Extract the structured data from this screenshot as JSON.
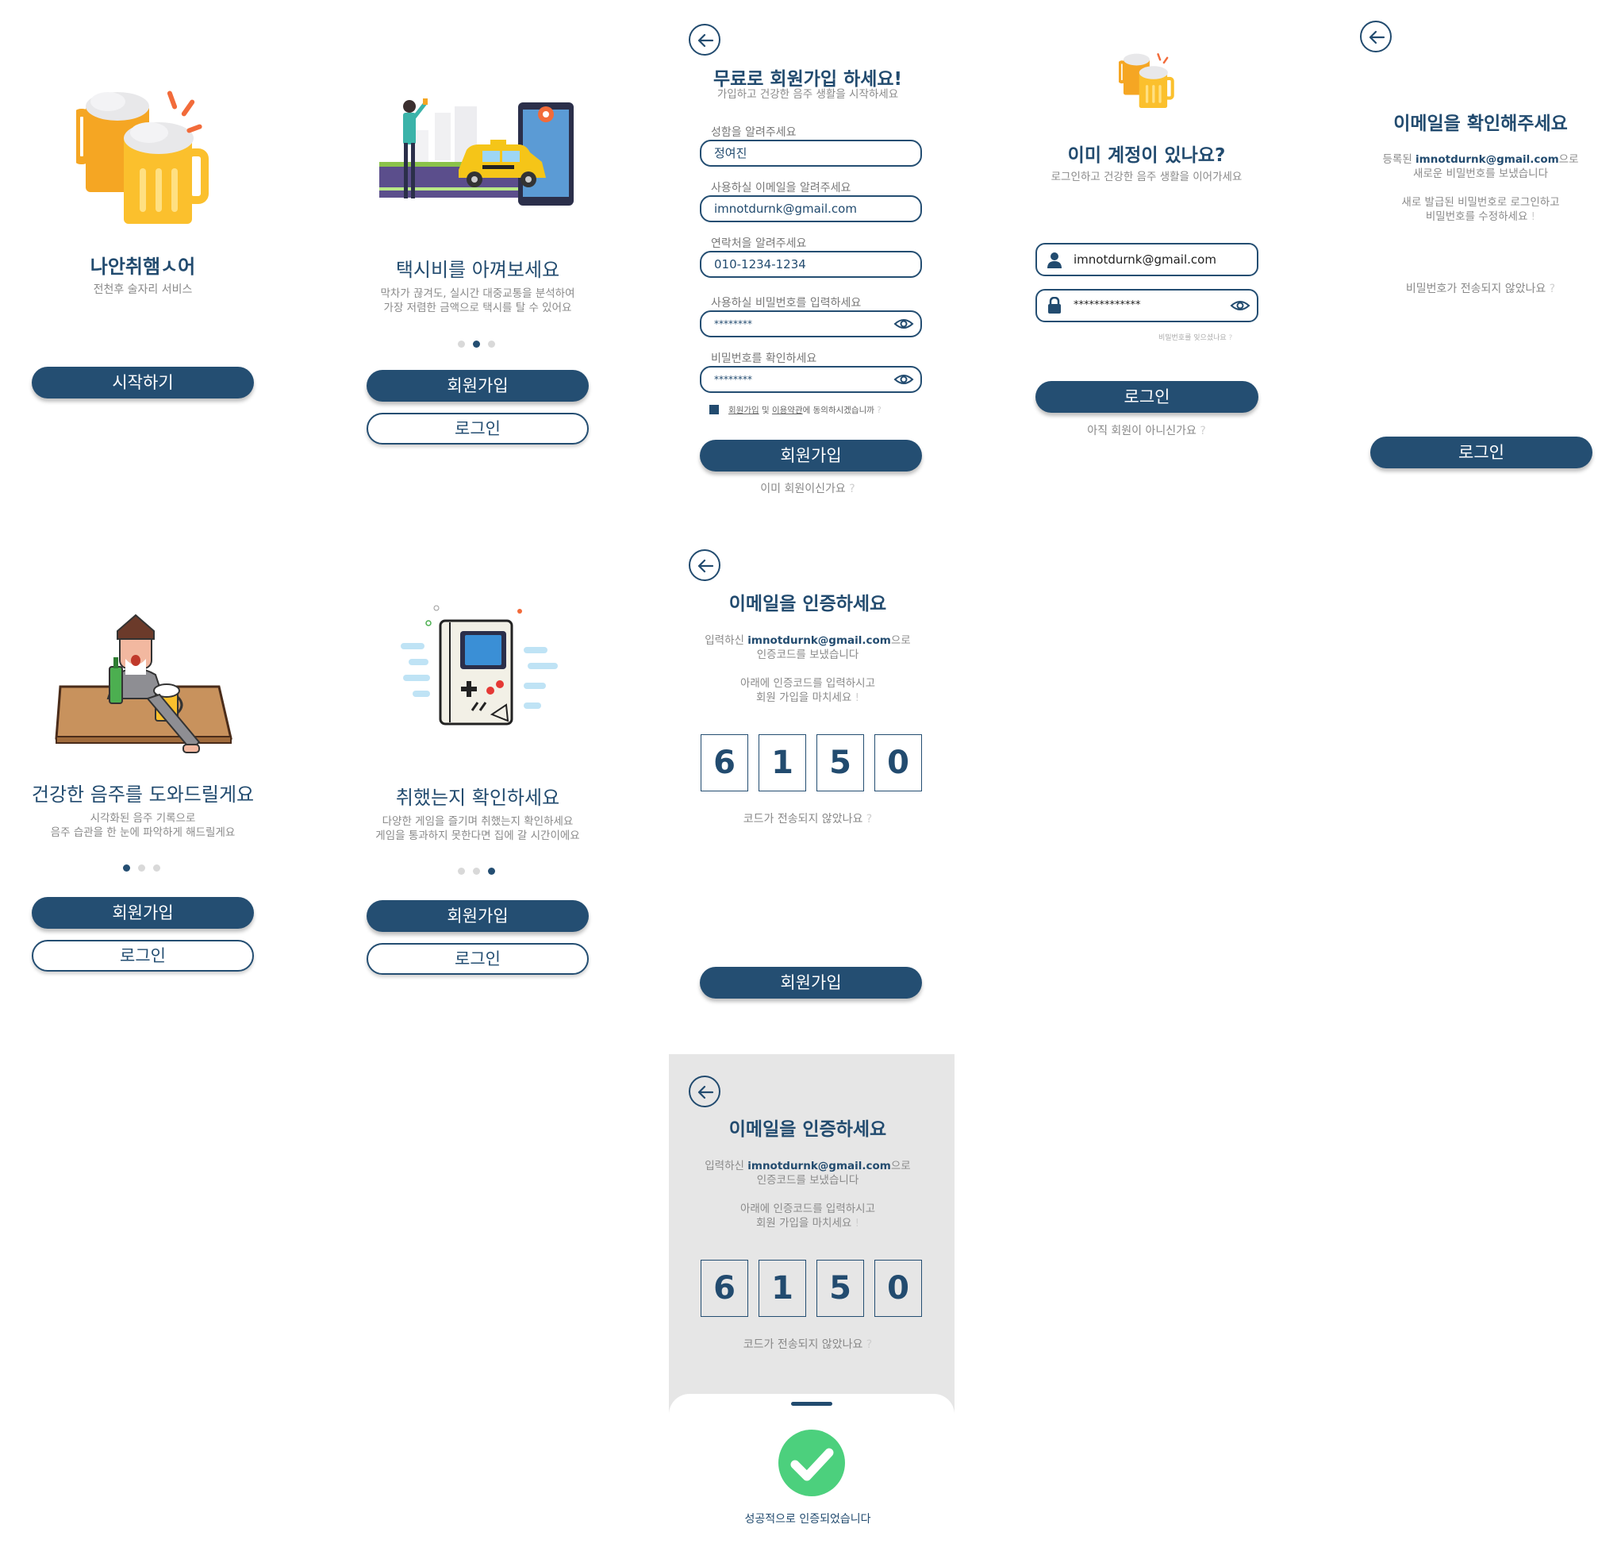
{
  "screen1": {
    "title": "나안취햄ㅅ어",
    "subtitle": "전천후 술자리 서비스",
    "start_button": "시작하기"
  },
  "screen2": {
    "title": "택시비를 아껴보세요",
    "desc_line1": "막차가 끊겨도, 실시간 대중교통을 분석하여",
    "desc_line2": "가장 저렴한 금액으로 택시를 탈 수 있어요",
    "signup_button": "회원가입",
    "login_button": "로그인"
  },
  "screen3": {
    "title": "무료로 회원가입 하세요!",
    "subtitle": "가입하고 건강한 음주 생활을 시작하세요",
    "name_label": "성함을 알려주세요",
    "name_value": "정여진",
    "email_label": "사용하실 이메일을 알려주세요",
    "email_value": "imnotdurnk@gmail.com",
    "phone_label": "연락처을 알려주세요",
    "phone_value": "010-1234-1234",
    "password_label": "사용하실 비밀번호를 입력하세요",
    "password_value": "********",
    "confirm_label": "비밀번호를 확인하세요",
    "confirm_value": "********",
    "agree_text_1": "회원가입",
    "agree_text_2": " 및 ",
    "agree_text_3": "이용약관",
    "agree_text_4": "에 동의하시겠습니까",
    "agree_q": " ?",
    "signup_button": "회원가입",
    "already_member": "이미 회원이신가요",
    "q": " ?"
  },
  "screen4": {
    "title": "이미 계정이 있나요?",
    "subtitle": "로그인하고 건강한 음주 생활을 이어가세요",
    "email_value": "imnotdurnk@gmail.com",
    "password_value": "*************",
    "forgot_password": "비밀번호를 잊으셨나요",
    "forgot_q": " ?",
    "login_button": "로그인",
    "not_member": "아직 회원이 아니신가요",
    "q": " ?"
  },
  "screen5": {
    "title": "이메일을 확인해주세요",
    "line1_prefix": "등록된 ",
    "line1_email": "imnotdurnk@gmail.com",
    "line1_suffix": "으로",
    "line2": "새로운 비밀번호를 보냈습니다",
    "line3": "새로 발급된 비밀번호로 로그인하고",
    "line4": "비밀번호를 수정하세요",
    "line4_mark": " !",
    "not_sent": "비밀번호가 전송되지 않았나요",
    "q": " ?",
    "login_button": "로그인"
  },
  "screen6": {
    "title": "건강한 음주를 도와드릴게요",
    "desc_line1": "시각화된 음주 기록으로",
    "desc_line2": "음주 습관을 한 눈에 파악하게 해드릴게요",
    "signup_button": "회원가입",
    "login_button": "로그인"
  },
  "screen7": {
    "title": "취했는지 확인하세요",
    "desc_line1": "다양한 게임을 즐기며 취했는지 확인하세요",
    "desc_line2": "게임을 통과하지 못한다면 집에 갈 시간이에요",
    "signup_button": "회원가입",
    "login_button": "로그인"
  },
  "screen8": {
    "title": "이메일을 인증하세요",
    "line1_prefix": "입력하신 ",
    "line1_email": "imnotdurnk@gmail.com",
    "line1_suffix": "으로",
    "line2": "인증코드를 보냈습니다",
    "line3": "아래에 인증코드를 입력하시고",
    "line4": "회원 가입을 마치세요",
    "line4_mark": " !",
    "code": [
      "6",
      "1",
      "5",
      "0"
    ],
    "not_sent": "코드가 전송되지 않았나요",
    "q": " ?",
    "signup_button": "회원가입"
  },
  "screen9": {
    "title": "이메일을 인증하세요",
    "line1_prefix": "입력하신 ",
    "line1_email": "imnotdurnk@gmail.com",
    "line1_suffix": "으로",
    "line2": "인증코드를 보냈습니다",
    "line3": "아래에 인증코드를 입력하시고",
    "line4": "회원 가입을 마치세요",
    "line4_mark": " !",
    "code": [
      "6",
      "1",
      "5",
      "0"
    ],
    "not_sent": "코드가 전송되지 않았나요",
    "q": " ?",
    "success_text": "성공적으로 인증되었습니다"
  },
  "colors": {
    "primary": "#244E72",
    "success": "#4CD07D",
    "overlay": "#E6E6E6"
  },
  "icons": [
    "back-arrow-icon",
    "eye-icon",
    "user-icon",
    "lock-icon",
    "check-icon",
    "beer-icon"
  ]
}
